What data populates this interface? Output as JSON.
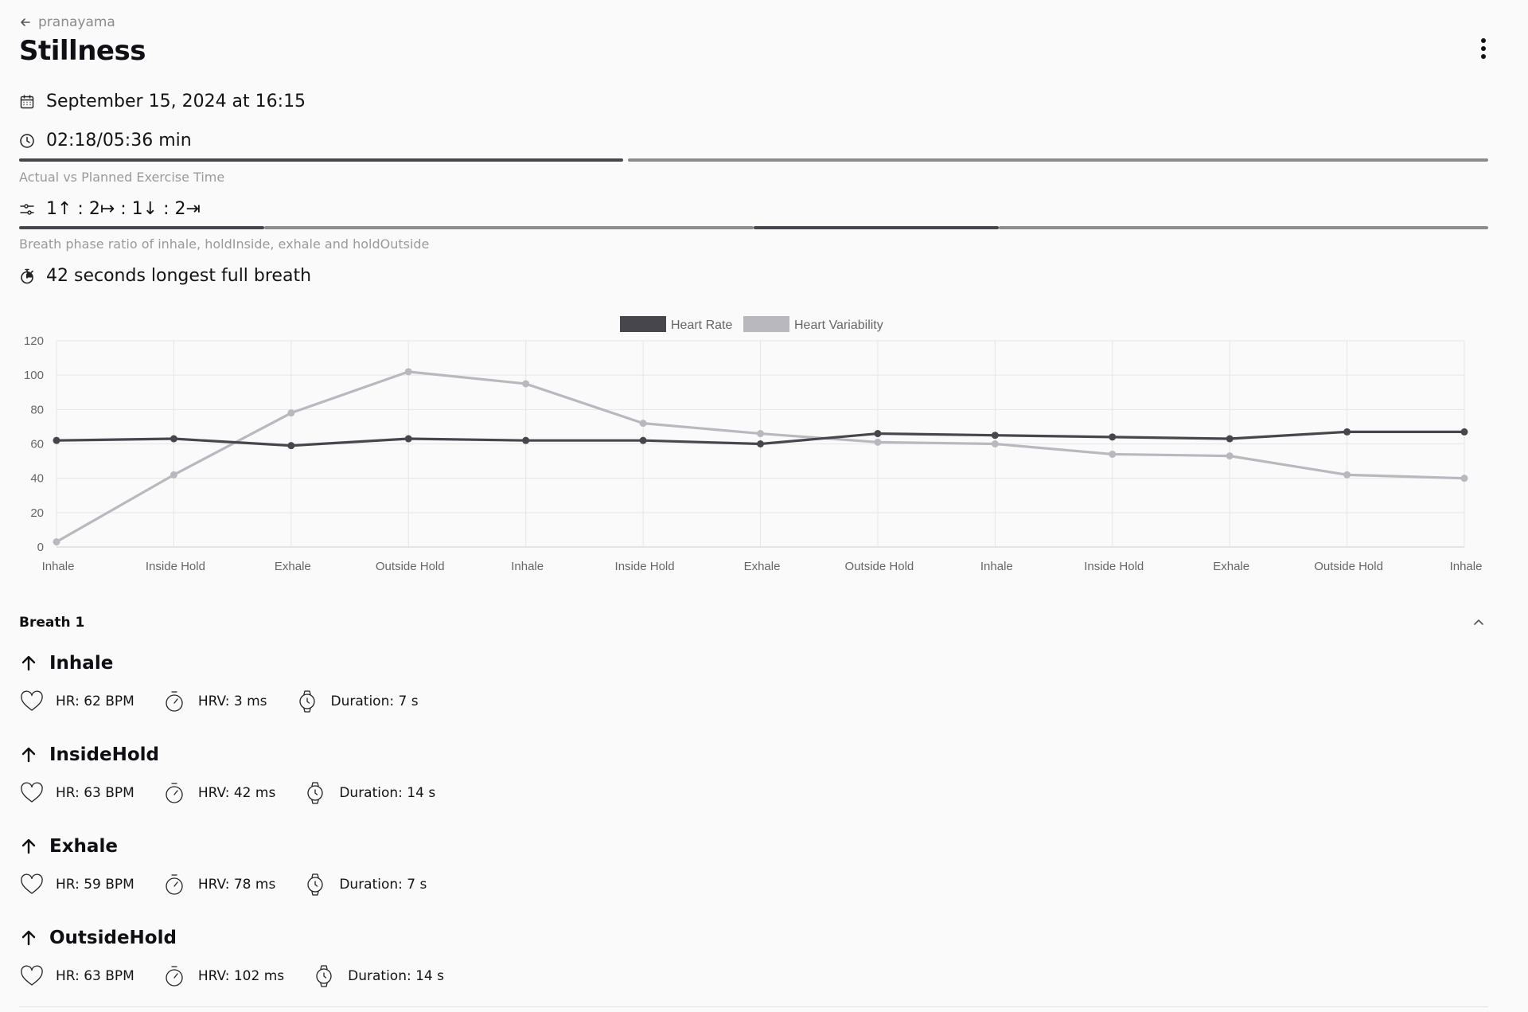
{
  "header": {
    "back_label": "pranayama",
    "title": "Stillness"
  },
  "session": {
    "date": "September 15, 2024 at 16:15",
    "time": "02:18/05:36 min",
    "time_progress": 0.411,
    "time_caption": "Actual vs Planned Exercise Time",
    "ratio_text": "1↑ : 2↦ : 1↓ : 2⇥",
    "ratio_caption": "Breath phase ratio of inhale, holdInside, exhale and holdOutside",
    "ratio_segments": [
      1,
      2,
      1,
      2
    ],
    "ratio_highlight_index": 2,
    "longest_breath": "42 seconds longest full breath"
  },
  "colors": {
    "dark": "#46464c",
    "light": "#b9b8be",
    "track": "#8c8c8c"
  },
  "chart_data": {
    "type": "line",
    "categories": [
      "Inhale",
      "Inside Hold",
      "Exhale",
      "Outside Hold",
      "Inhale",
      "Inside Hold",
      "Exhale",
      "Outside Hold",
      "Inhale",
      "Inside Hold",
      "Exhale",
      "Outside Hold",
      "Inhale"
    ],
    "series": [
      {
        "name": "Heart Rate",
        "color": "#46464c",
        "values": [
          62,
          63,
          59,
          63,
          62,
          62,
          60,
          66,
          65,
          64,
          63,
          67,
          67
        ]
      },
      {
        "name": "Heart Variability",
        "color": "#b9b8be",
        "values": [
          3,
          42,
          78,
          102,
          95,
          72,
          66,
          61,
          60,
          54,
          53,
          42,
          40
        ]
      }
    ],
    "ylim": [
      0,
      120
    ],
    "yticks": [
      0,
      20,
      40,
      60,
      80,
      100,
      120
    ],
    "grid": true,
    "legend_position": "top-center"
  },
  "breath": {
    "title": "Breath 1",
    "phases": [
      {
        "name": "Inhale",
        "hr": "HR: 62 BPM",
        "hrv": "HRV: 3 ms",
        "duration": "Duration: 7 s"
      },
      {
        "name": "InsideHold",
        "hr": "HR: 63 BPM",
        "hrv": "HRV: 42 ms",
        "duration": "Duration: 14 s"
      },
      {
        "name": "Exhale",
        "hr": "HR: 59 BPM",
        "hrv": "HRV: 78 ms",
        "duration": "Duration: 7 s"
      },
      {
        "name": "OutsideHold",
        "hr": "HR: 63 BPM",
        "hrv": "HRV: 102 ms",
        "duration": "Duration: 14 s"
      }
    ]
  },
  "icons": {
    "back": "arrow-left-icon",
    "menu": "more-vertical-icon",
    "date": "calendar-icon",
    "time": "clock-icon",
    "ratio": "sliders-icon",
    "longest": "stopwatch-icon",
    "collapse": "chevron-up-icon",
    "phase": "arrow-up-icon",
    "hr": "heart-icon",
    "hrv": "timer-icon",
    "duration": "watch-icon"
  }
}
